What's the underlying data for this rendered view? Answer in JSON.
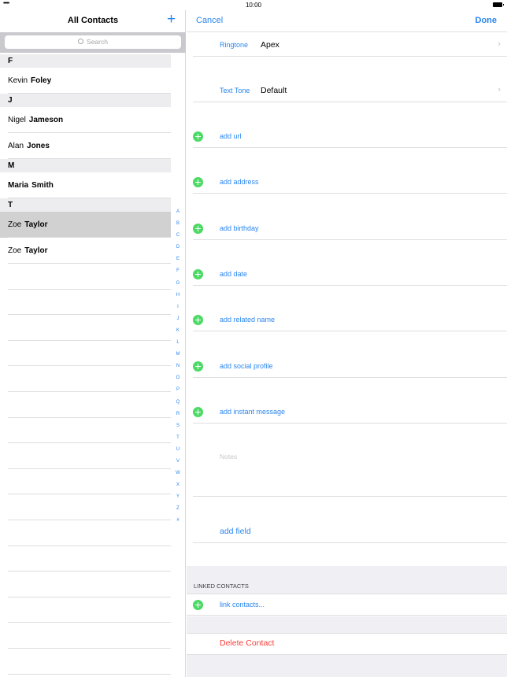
{
  "status_bar": {
    "signal": "•••••",
    "time": "10:00"
  },
  "left": {
    "title": "All Contacts",
    "add_icon": "+",
    "search_placeholder": "Search",
    "sections": [
      {
        "letter": "F",
        "contacts": [
          {
            "first": "Kevin",
            "last": "Foley",
            "selected": false
          }
        ]
      },
      {
        "letter": "J",
        "contacts": [
          {
            "first": "Nigel",
            "last": "Jameson",
            "selected": false
          },
          {
            "first": "Alan",
            "last": "Jones",
            "selected": false
          }
        ]
      },
      {
        "letter": "M",
        "contacts": [
          {
            "first": "Maria",
            "last": "Smith",
            "selected": false
          }
        ]
      },
      {
        "letter": "T",
        "contacts": [
          {
            "first": "Zoe",
            "last": "Taylor",
            "selected": true
          },
          {
            "first": "Zoe",
            "last": "Taylor",
            "selected": false
          }
        ]
      }
    ],
    "index": [
      "A",
      "B",
      "C",
      "D",
      "E",
      "F",
      "G",
      "H",
      "I",
      "J",
      "K",
      "L",
      "M",
      "N",
      "O",
      "P",
      "Q",
      "R",
      "S",
      "T",
      "U",
      "V",
      "W",
      "X",
      "Y",
      "Z",
      "#"
    ]
  },
  "right": {
    "cancel_label": "Cancel",
    "done_label": "Done",
    "ringtone": {
      "label": "Ringtone",
      "value": "Apex"
    },
    "text_tone": {
      "label": "Text Tone",
      "value": "Default"
    },
    "add_rows": [
      "add url",
      "add address",
      "add birthday",
      "add date",
      "add related name",
      "add social profile",
      "add instant message"
    ],
    "notes_placeholder": "Notes",
    "add_field_label": "add field",
    "linked_header": "LINKED CONTACTS",
    "link_contacts_label": "link contacts...",
    "delete_label": "Delete Contact"
  },
  "colors": {
    "accent": "#2b86ef",
    "add_green": "#4cd964",
    "destructive": "#fc3d39",
    "selection": "#d1d1d1"
  },
  "icons": {
    "search": "magnifier-icon",
    "chevron": "chevron-right-icon",
    "add": "plus-circle-icon"
  }
}
